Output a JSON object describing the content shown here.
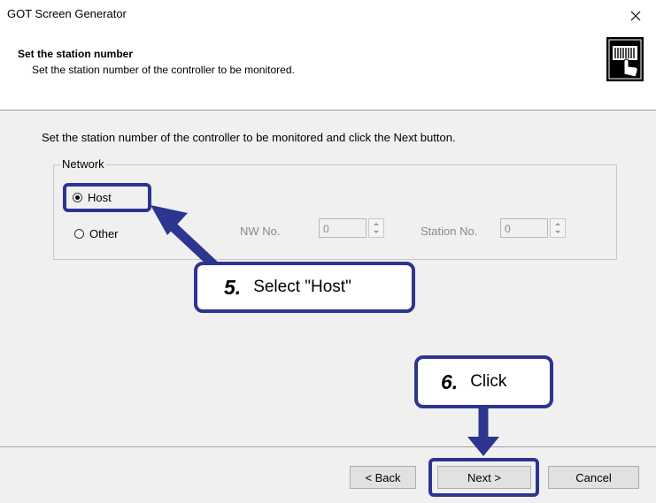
{
  "window": {
    "title": "GOT Screen Generator",
    "close_glyph": "✕"
  },
  "header": {
    "title": "Set the station number",
    "subtitle": "Set the station number of the controller to be monitored.",
    "icon": "controller-hand-icon"
  },
  "main": {
    "instruction": "Set the station number of the controller to be monitored and click the Next button.",
    "group_label": "Network",
    "options": [
      {
        "label": "Host",
        "selected": true
      },
      {
        "label": "Other",
        "selected": false
      }
    ],
    "nw_no": {
      "label": "NW No.",
      "value": "0"
    },
    "station_no": {
      "label": "Station No.",
      "value": "0"
    }
  },
  "buttons": {
    "back": "< Back",
    "next": "Next >",
    "cancel": "Cancel"
  },
  "callouts": [
    {
      "num": "5.",
      "text": "Select \"Host\""
    },
    {
      "num": "6.",
      "text": "Click"
    }
  ],
  "colors": {
    "accent": "#2c3590",
    "dialog_bg": "#f0f0f0"
  }
}
